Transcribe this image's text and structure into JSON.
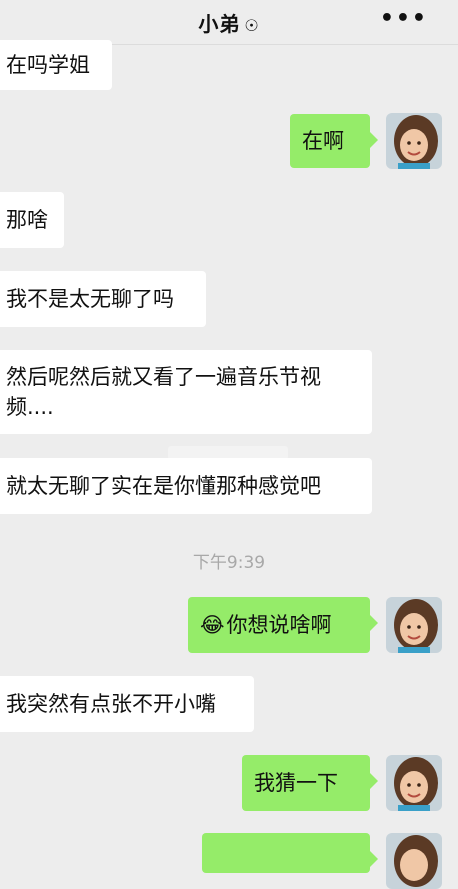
{
  "header": {
    "title": "小弟",
    "status_icon": "☉",
    "more_label": "•••"
  },
  "messages": [
    {
      "side": "left",
      "text": "在吗学姐"
    },
    {
      "side": "right",
      "text": "在啊"
    },
    {
      "side": "left",
      "text": "那啥"
    },
    {
      "side": "left",
      "text": "我不是太无聊了吗"
    },
    {
      "side": "left",
      "text_line1": "然后呢然后就又看了一遍音乐节视",
      "text_line2": "频...."
    },
    {
      "side": "left",
      "text": "就太无聊了实在是你懂那种感觉吧"
    },
    {
      "side": "right",
      "emoji": "😂",
      "text": "你想说啥啊"
    },
    {
      "side": "left",
      "text": "我突然有点张不开小嘴"
    },
    {
      "side": "right",
      "text": "我猜一下"
    }
  ],
  "timestamp": "下午9:39",
  "colors": {
    "background": "#ededed",
    "bubble_left": "#ffffff",
    "bubble_right": "#95ec69"
  },
  "avatar_icon": "girl-avatar"
}
